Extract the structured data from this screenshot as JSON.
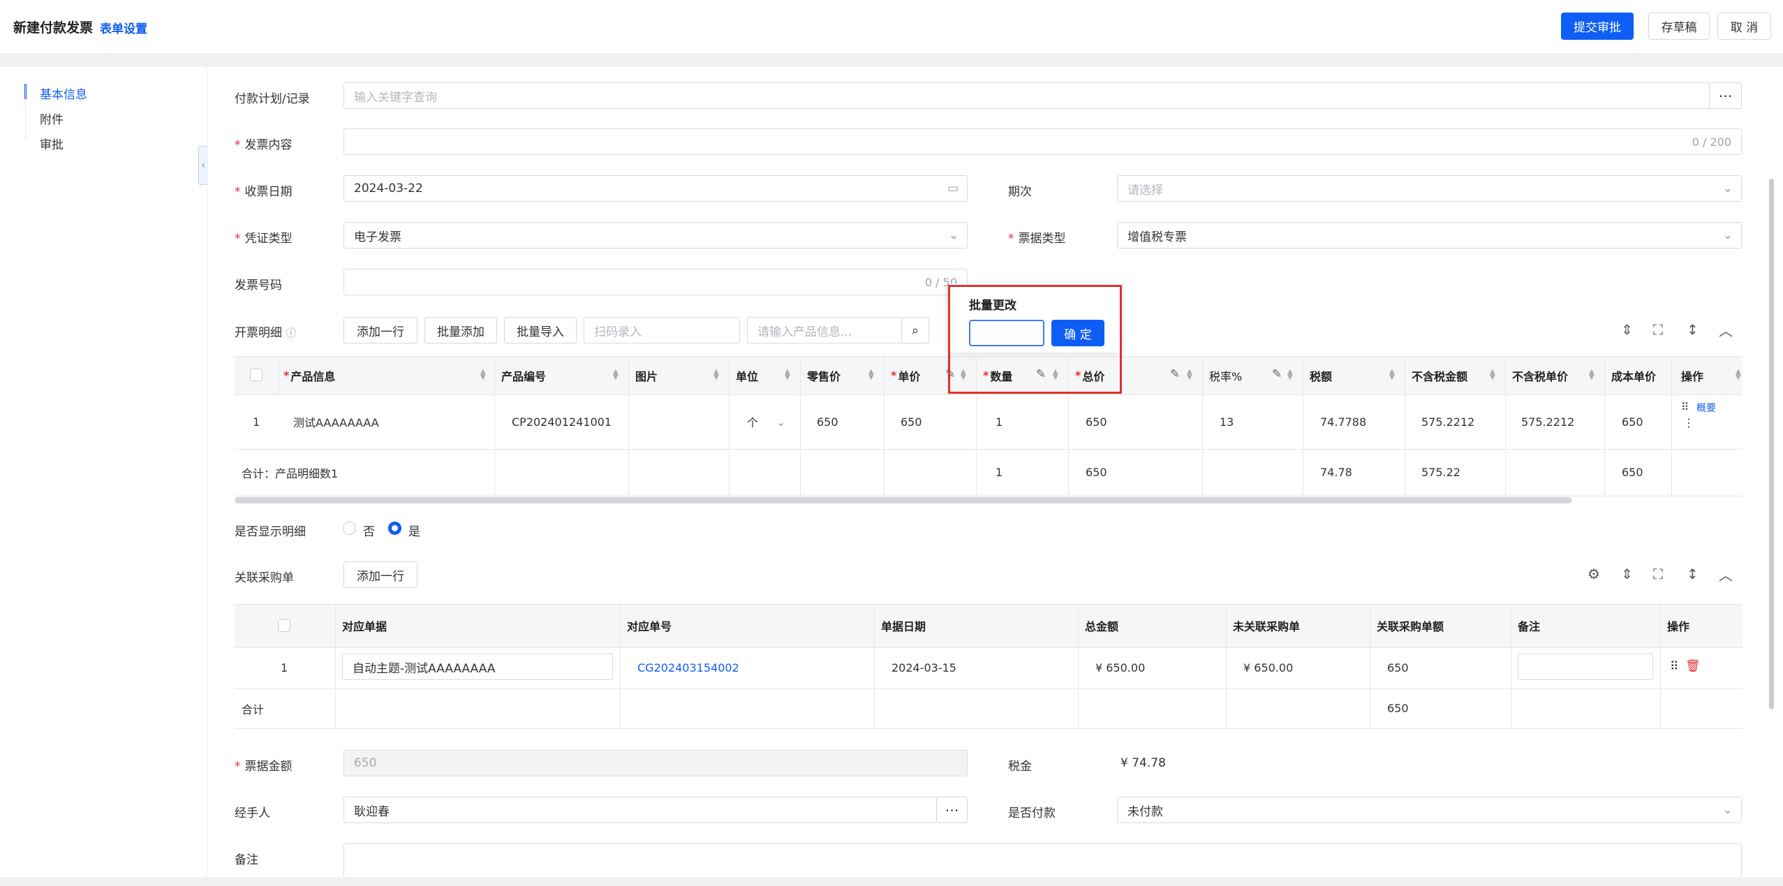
{
  "header": {
    "title": "新建付款发票",
    "form_settings": "表单设置",
    "submit": "提交审批",
    "draft": "存草稿",
    "cancel": "取 消"
  },
  "anchors": [
    {
      "label": "基本信息"
    },
    {
      "label": "附件"
    },
    {
      "label": "审批"
    }
  ],
  "form": {
    "plan_label": "付款计划/记录",
    "plan_placeholder": "输入关键字查询",
    "content_label": "发票内容",
    "content_count": "0 / 200",
    "date_label": "收票日期",
    "date_value": "2024-03-22",
    "period_label": "期次",
    "period_placeholder": "请选择",
    "voucher_label": "凭证类型",
    "voucher_value": "电子发票",
    "ticket_type_label": "票据类型",
    "ticket_type_value": "增值税专票",
    "invoice_no_label": "发票号码",
    "invoice_no_count": "0 / 50"
  },
  "detail": {
    "label": "开票明细",
    "add_row": "添加一行",
    "batch_add": "批量添加",
    "batch_import": "批量导入",
    "scan_placeholder": "扫码录入",
    "product_placeholder": "请输入产品信息...",
    "columns": [
      "产品信息",
      "产品编号",
      "图片",
      "单位",
      "零售价",
      "单价",
      "数量",
      "总价",
      "税率%",
      "税额",
      "不含税金额",
      "不含税单价",
      "成本单价",
      "操作"
    ],
    "row": {
      "index": "1",
      "product": "测试AAAAAAAA",
      "code": "CP202401241001",
      "unit": "个",
      "retail": "650",
      "price": "650",
      "qty": "1",
      "total": "650",
      "tax_rate": "13",
      "tax": "74.7788",
      "ex_amount": "575.2212",
      "ex_price": "575.2212",
      "cost": "650",
      "op": "概要"
    },
    "sum": {
      "label": "合计：产品明细数1",
      "qty": "1",
      "total": "650",
      "tax": "74.78",
      "ex_amount": "575.22",
      "cost": "650"
    }
  },
  "popover": {
    "title": "批量更改",
    "confirm": "确 定"
  },
  "show_detail": {
    "label": "是否显示明细",
    "no": "否",
    "yes": "是"
  },
  "purchase": {
    "label": "关联采购单",
    "add_row": "添加一行",
    "columns": [
      "对应单据",
      "对应单号",
      "单据日期",
      "总金额",
      "未关联采购单",
      "关联采购单额",
      "备注",
      "操作"
    ],
    "row": {
      "index": "1",
      "doc": "自动主题-测试AAAAAAAA",
      "no": "CG202403154002",
      "date": "2024-03-15",
      "amount": "¥ 650.00",
      "unlinked": "¥ 650.00",
      "linked": "650"
    },
    "sum": {
      "label": "合计",
      "linked": "650"
    }
  },
  "bottom": {
    "amount_label": "票据金额",
    "amount_value": "650",
    "tax_label": "税金",
    "tax_value": "¥ 74.78",
    "handler_label": "经手人",
    "handler_value": "耿迎春",
    "paid_label": "是否付款",
    "paid_value": "未付款",
    "remark_label": "备注"
  },
  "colors": {
    "primary": "#0e5ef5",
    "required": "#e0302f",
    "highlight": "#e0302f"
  }
}
